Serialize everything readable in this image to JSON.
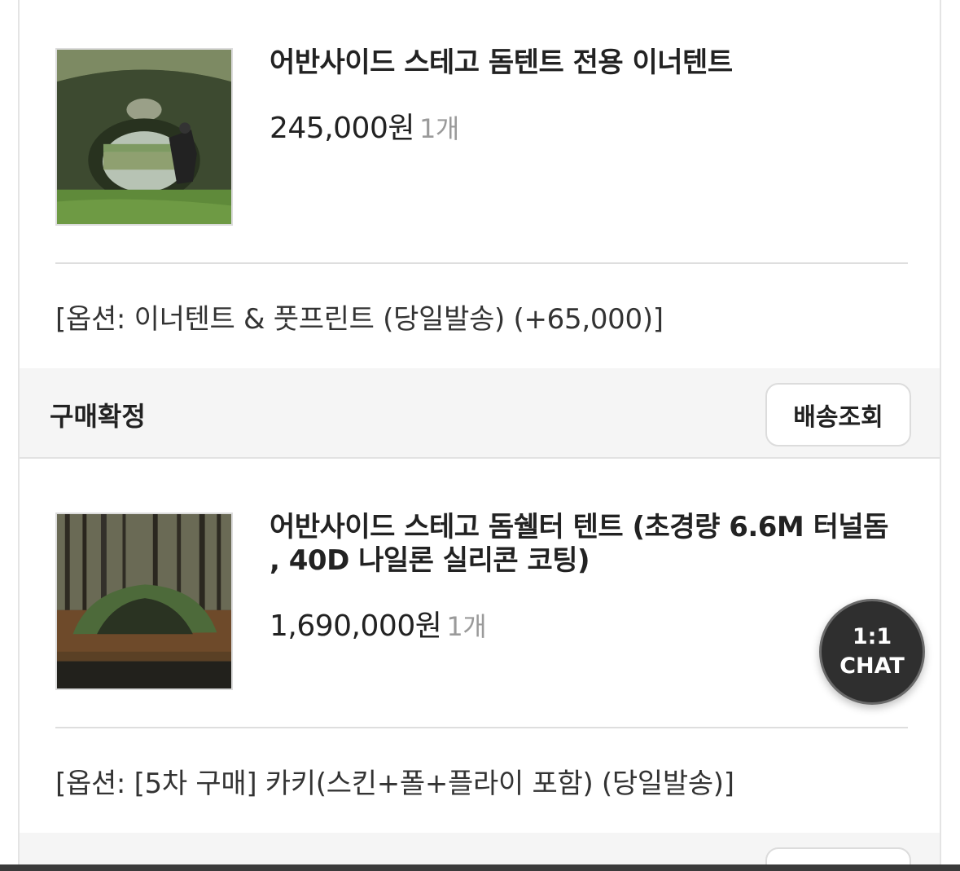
{
  "orders": [
    {
      "product_name": "어반사이드 스테고 돔텐트 전용 이너텐트",
      "price": "245,000원",
      "quantity": "1개",
      "option": "[옵션: 이너텐트 & 풋프린트 (당일발송) (+65,000)]",
      "thumbnail_icon": "tent-interior-photo"
    },
    {
      "product_name": "어반사이드 스테고 돔쉘터 텐트 (초경량 6.6M 터널돔 , 40D 나일론 실리콘 코팅)",
      "price": "1,690,000원",
      "quantity": "1개",
      "option": "[옵션: [5차 구매] 카키(스킨+폴+플라이 포함) (당일발송)]",
      "thumbnail_icon": "dome-tent-forest-photo"
    }
  ],
  "status": {
    "label": "구매확정",
    "track_button": "배송조회"
  },
  "chat": {
    "line1": "1:1",
    "line2": "CHAT"
  }
}
